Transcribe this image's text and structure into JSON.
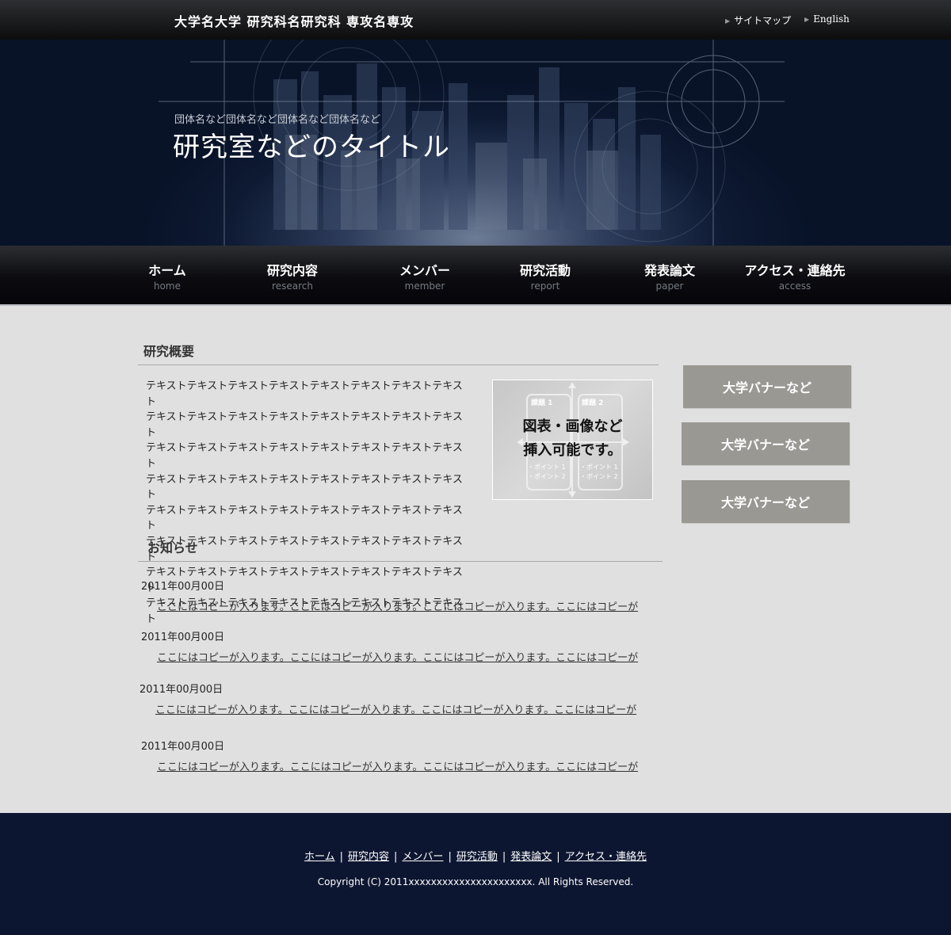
{
  "header": {
    "site_title": "大学名大学 研究科名研究科 専攻名専攻",
    "links": [
      {
        "label": "サイトマップ"
      },
      {
        "label": "English"
      }
    ]
  },
  "hero": {
    "subtitle": "団体名など団体名など団体名など団体名など",
    "title": "研究室などのタイトル"
  },
  "nav": [
    {
      "label": "ホーム",
      "sub": "home"
    },
    {
      "label": "研究内容",
      "sub": "research"
    },
    {
      "label": "メンバー",
      "sub": "member"
    },
    {
      "label": "研究活動",
      "sub": "report"
    },
    {
      "label": "発表論文",
      "sub": "paper"
    },
    {
      "label": "アクセス・連絡先",
      "sub": "access"
    }
  ],
  "overview": {
    "heading": "研究概要",
    "lines": [
      "テキストテキストテキストテキストテキストテキストテキストテキスト",
      "テキストテキストテキストテキストテキストテキストテキストテキスト",
      "テキストテキストテキストテキストテキストテキストテキストテキスト",
      "テキストテキストテキストテキストテキストテキストテキストテキスト",
      "テキストテキストテキストテキストテキストテキストテキストテキスト",
      "テキストテキストテキストテキストテキストテキストテキストテキスト",
      "テキストテキストテキストテキストテキストテキストテキストテキスト",
      "テキストテキストテキストテキストテキストテキストテキストテキスト"
    ],
    "figure": {
      "caption_line1": "図表・画像など",
      "caption_line2": "挿入可能です。",
      "box_labels": [
        "課題 1",
        "課題 2"
      ],
      "point_labels": [
        "・ポイント 1",
        "・ポイント 2"
      ]
    }
  },
  "banners": [
    {
      "label": "大学バナーなど"
    },
    {
      "label": "大学バナーなど"
    },
    {
      "label": "大学バナーなど"
    }
  ],
  "news": {
    "heading": "お知らせ",
    "items": [
      {
        "date": "2011年00月00日",
        "text": "ここにはコピーが入ります。ここにはコピーが入ります。ここにはコピーが入ります。ここにはコピーが"
      },
      {
        "date": "2011年00月00日",
        "text": "ここにはコピーが入ります。ここにはコピーが入ります。ここにはコピーが入ります。ここにはコピーが"
      },
      {
        "date": "2011年00月00日",
        "text": "ここにはコピーが入ります。ここにはコピーが入ります。ここにはコピーが入ります。ここにはコピーが"
      },
      {
        "date": "2011年00月00日",
        "text": "ここにはコピーが入ります。ここにはコピーが入ります。ここにはコピーが入ります。ここにはコピーが"
      }
    ]
  },
  "footer": {
    "links": [
      {
        "label": "ホーム"
      },
      {
        "label": "研究内容"
      },
      {
        "label": "メンバー"
      },
      {
        "label": "研究活動"
      },
      {
        "label": "発表論文"
      },
      {
        "label": "アクセス・連絡先"
      }
    ],
    "separator": "|",
    "copyright": "Copyright (C) 2011xxxxxxxxxxxxxxxxxxxxxx. All Rights Reserved."
  }
}
